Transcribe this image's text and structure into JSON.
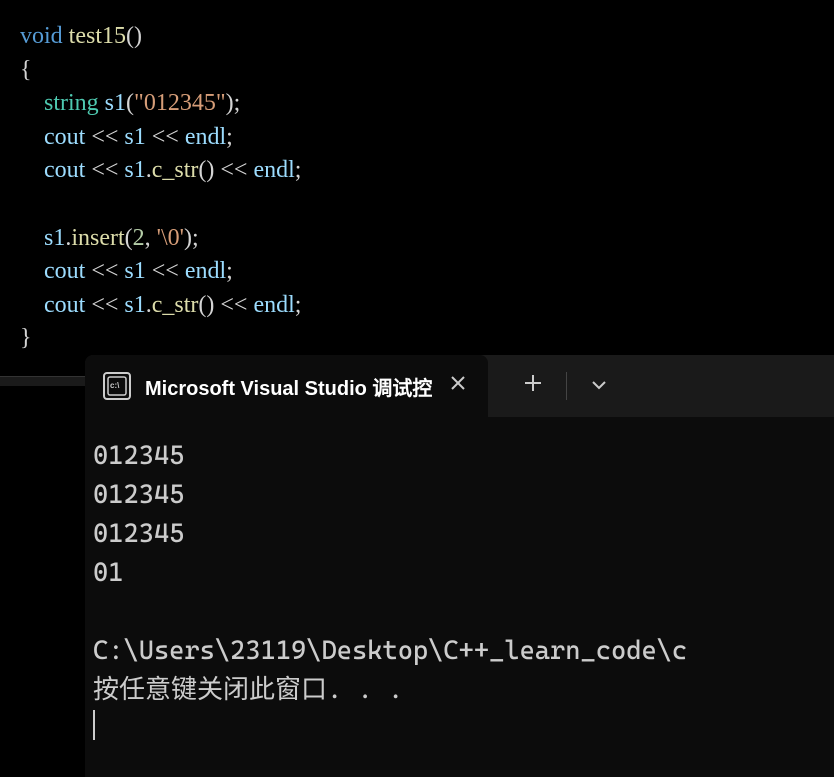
{
  "code": {
    "line1": {
      "void": "void",
      "func": "test15",
      "parens": "()"
    },
    "line2": "{",
    "line3": {
      "type": "string",
      "var": "s1",
      "open": "(",
      "str": "\"012345\"",
      "close": ");"
    },
    "line4": {
      "cout": "cout",
      "op1": " << ",
      "var": "s1",
      "op2": " << ",
      "endl": "endl",
      "semi": ";"
    },
    "line5": {
      "cout": "cout",
      "op1": " << ",
      "var": "s1",
      "dot": ".",
      "method": "c_str",
      "parens": "()",
      "op2": " << ",
      "endl": "endl",
      "semi": ";"
    },
    "line7": {
      "var": "s1",
      "dot": ".",
      "method": "insert",
      "open": "(",
      "num": "2",
      "comma": ", ",
      "char": "'\\0'",
      "close": ");"
    },
    "line8": {
      "cout": "cout",
      "op1": " << ",
      "var": "s1",
      "op2": " << ",
      "endl": "endl",
      "semi": ";"
    },
    "line9": {
      "cout": "cout",
      "op1": " << ",
      "var": "s1",
      "dot": ".",
      "method": "c_str",
      "parens": "()",
      "op2": " << ",
      "endl": "endl",
      "semi": ";"
    },
    "line10": "}"
  },
  "terminal": {
    "tab_title": "Microsoft Visual Studio 调试控",
    "tab_icon": "c:\\",
    "output": {
      "line1": "012345",
      "line2": "012345",
      "line3": "012345",
      "line4": "01",
      "line5": "",
      "line6": "C:\\Users\\23119\\Desktop\\C++_learn_code\\c",
      "line7": "按任意键关闭此窗口. . ."
    }
  }
}
